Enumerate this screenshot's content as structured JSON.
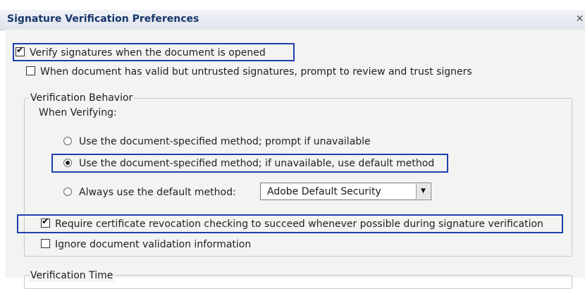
{
  "window": {
    "title": "Signature Verification Preferences",
    "close_glyph": "✕"
  },
  "options": {
    "verify_on_open": {
      "label": "Verify signatures when the document is opened",
      "checked": true
    },
    "prompt_untrusted": {
      "label": "When document has valid but untrusted signatures, prompt to review and trust signers",
      "checked": false
    }
  },
  "verification_behavior": {
    "group_label": "Verification Behavior",
    "when_verifying": "When Verifying:",
    "radio_prompt": {
      "label": "Use the document-specified method; prompt if unavailable",
      "selected": false
    },
    "radio_default_fallback": {
      "label": "Use the document-specified method; if unavailable, use default method",
      "selected": true
    },
    "radio_always_default": {
      "label": "Always use the default method:",
      "selected": false
    },
    "default_method_select": {
      "value": "Adobe Default Security"
    },
    "require_revocation": {
      "label": "Require certificate revocation checking to succeed whenever possible during signature verification",
      "checked": true
    },
    "ignore_validation": {
      "label": "Ignore document validation information",
      "checked": false
    }
  },
  "verification_time": {
    "group_label": "Verification Time"
  },
  "glyphs": {
    "check": "✔",
    "dropdown": "▼"
  },
  "colors": {
    "highlight_border": "#1e3fb0",
    "title_text": "#17366b"
  }
}
